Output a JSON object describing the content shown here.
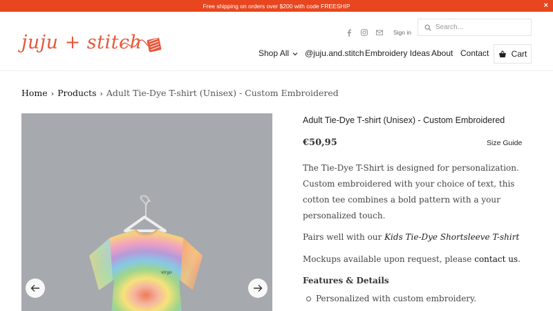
{
  "announcement": {
    "text": "Free shipping on orders over $200 with code FREESHIP",
    "close": "×"
  },
  "logo": {
    "text": "juju + stitch"
  },
  "utility": {
    "signin": "Sign in"
  },
  "search": {
    "placeholder": "Search..."
  },
  "nav": {
    "shop_all": "Shop All",
    "instagram": "@juju.and.stitch",
    "embroidery": "Embroidery Ideas",
    "about": "About",
    "contact": "Contact",
    "cart": "Cart"
  },
  "breadcrumb": {
    "home": "Home",
    "products": "Products",
    "current": "Adult Tie-Dye T-shirt (Unisex) - Custom Embroidered"
  },
  "product": {
    "title": "Adult Tie-Dye T-shirt (Unisex) - Custom Embroidered",
    "price": "€50,95",
    "size_guide": "Size Guide",
    "desc_1": "The Tie-Dye T-Shirt is designed for personalization. Custom embroidered with your choice of text, this cotton tee combines a bold pattern with a your personalized touch.",
    "desc_2_prefix": "Pairs well with our ",
    "desc_2_link": "Kids Tie-Dye Shortsleeve T-shirt",
    "desc_3_prefix": "Mockups available upon request, please ",
    "desc_3_link": "contact us",
    "desc_3_suffix": ".",
    "features_heading": "Features & Details",
    "features": [
      "Personalized with custom embroidery."
    ],
    "shirt_embroidery": "virgo"
  },
  "colors": {
    "accent": "#e8461f",
    "logo": "#e8573a",
    "image_bg": "#a6a9ad"
  },
  "icons": [
    "facebook-icon",
    "instagram-icon",
    "email-icon",
    "search-icon",
    "chevron-down-icon",
    "cart-icon",
    "arrow-left-icon",
    "arrow-right-icon"
  ]
}
